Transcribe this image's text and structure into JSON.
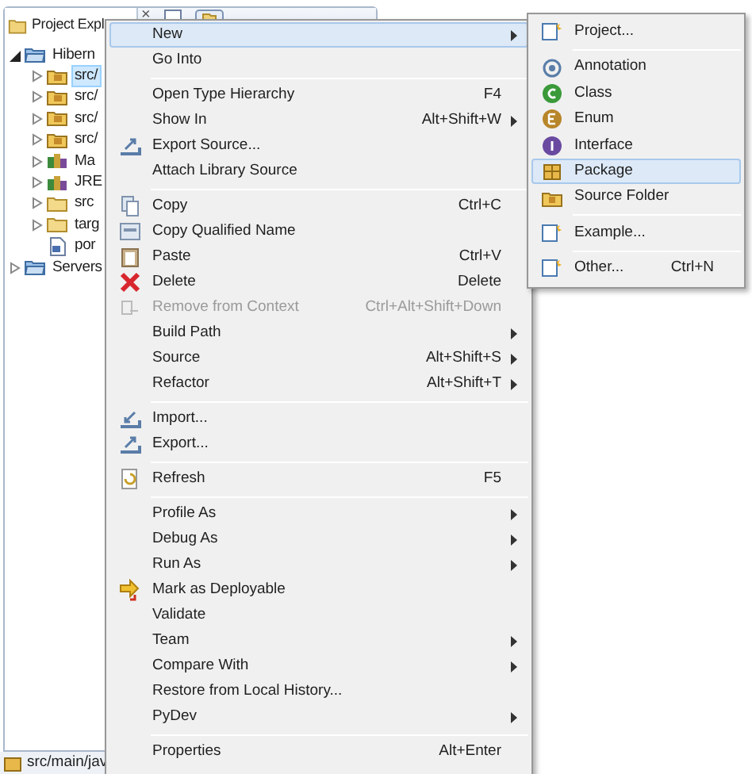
{
  "explorer": {
    "title": "Project Expl",
    "close": "×",
    "tree": [
      {
        "label": "Hibern",
        "kind": "project",
        "expanded": true,
        "selected": false,
        "children": [
          {
            "label": "src/",
            "kind": "source-folder",
            "selected": true
          },
          {
            "label": "src/",
            "kind": "source-folder",
            "selected": false
          },
          {
            "label": "src/",
            "kind": "source-folder",
            "selected": false
          },
          {
            "label": "src/",
            "kind": "source-folder",
            "selected": false
          },
          {
            "label": "Ma",
            "kind": "library",
            "selected": false
          },
          {
            "label": "JRE",
            "kind": "library",
            "selected": false
          },
          {
            "label": "src",
            "kind": "folder",
            "selected": false
          },
          {
            "label": "targ",
            "kind": "folder",
            "selected": false
          },
          {
            "label": "por",
            "kind": "file",
            "selected": false
          }
        ]
      },
      {
        "label": "Servers",
        "kind": "project",
        "expanded": false,
        "selected": false
      }
    ]
  },
  "status_bar": {
    "text": "src/main/jav"
  },
  "context_menu": [
    {
      "kind": "item",
      "label": "New",
      "submenu": true,
      "selected": true,
      "disabled": false
    },
    {
      "kind": "item",
      "label": "Go Into",
      "submenu": false,
      "selected": false,
      "disabled": false
    },
    {
      "kind": "separator"
    },
    {
      "kind": "item",
      "label": "Open Type Hierarchy",
      "shortcut": "F4",
      "submenu": false,
      "selected": false,
      "disabled": false
    },
    {
      "kind": "item",
      "label": "Show In",
      "shortcut": "Alt+Shift+W",
      "submenu": true,
      "selected": false,
      "disabled": false
    },
    {
      "kind": "item",
      "label": "Export Source...",
      "submenu": false,
      "selected": false,
      "disabled": false
    },
    {
      "kind": "item",
      "label": "Attach Library Source",
      "submenu": false,
      "selected": false,
      "disabled": false
    },
    {
      "kind": "separator"
    },
    {
      "kind": "item",
      "label": "Copy",
      "shortcut": "Ctrl+C",
      "submenu": false,
      "selected": false,
      "disabled": false
    },
    {
      "kind": "item",
      "label": "Copy Qualified Name",
      "submenu": false,
      "selected": false,
      "disabled": false
    },
    {
      "kind": "item",
      "label": "Paste",
      "shortcut": "Ctrl+V",
      "submenu": false,
      "selected": false,
      "disabled": false
    },
    {
      "kind": "item",
      "label": "Delete",
      "shortcut": "Delete",
      "submenu": false,
      "selected": false,
      "disabled": false
    },
    {
      "kind": "item",
      "label": "Remove from Context",
      "shortcut": "Ctrl+Alt+Shift+Down",
      "submenu": false,
      "selected": false,
      "disabled": true
    },
    {
      "kind": "item",
      "label": "Build Path",
      "submenu": true,
      "selected": false,
      "disabled": false
    },
    {
      "kind": "item",
      "label": "Source",
      "shortcut": "Alt+Shift+S",
      "submenu": true,
      "selected": false,
      "disabled": false
    },
    {
      "kind": "item",
      "label": "Refactor",
      "shortcut": "Alt+Shift+T",
      "submenu": true,
      "selected": false,
      "disabled": false
    },
    {
      "kind": "separator"
    },
    {
      "kind": "item",
      "label": "Import...",
      "submenu": false,
      "selected": false,
      "disabled": false
    },
    {
      "kind": "item",
      "label": "Export...",
      "submenu": false,
      "selected": false,
      "disabled": false
    },
    {
      "kind": "separator"
    },
    {
      "kind": "item",
      "label": "Refresh",
      "shortcut": "F5",
      "submenu": false,
      "selected": false,
      "disabled": false
    },
    {
      "kind": "separator"
    },
    {
      "kind": "item",
      "label": "Profile As",
      "submenu": true,
      "selected": false,
      "disabled": false
    },
    {
      "kind": "item",
      "label": "Debug As",
      "submenu": true,
      "selected": false,
      "disabled": false
    },
    {
      "kind": "item",
      "label": "Run As",
      "submenu": true,
      "selected": false,
      "disabled": false
    },
    {
      "kind": "item",
      "label": "Mark as Deployable",
      "submenu": false,
      "selected": false,
      "disabled": false
    },
    {
      "kind": "item",
      "label": "Validate",
      "submenu": false,
      "selected": false,
      "disabled": false
    },
    {
      "kind": "item",
      "label": "Team",
      "submenu": true,
      "selected": false,
      "disabled": false
    },
    {
      "kind": "item",
      "label": "Compare With",
      "submenu": true,
      "selected": false,
      "disabled": false
    },
    {
      "kind": "item",
      "label": "Restore from Local History...",
      "submenu": false,
      "selected": false,
      "disabled": false
    },
    {
      "kind": "item",
      "label": "PyDev",
      "submenu": true,
      "selected": false,
      "disabled": false
    },
    {
      "kind": "separator"
    },
    {
      "kind": "item",
      "label": "Properties",
      "shortcut": "Alt+Enter",
      "submenu": false,
      "selected": false,
      "disabled": false
    }
  ],
  "new_submenu": [
    {
      "kind": "item",
      "label": "Project...",
      "selected": false
    },
    {
      "kind": "separator"
    },
    {
      "kind": "item",
      "label": "Annotation",
      "selected": false
    },
    {
      "kind": "item",
      "label": "Class",
      "selected": false
    },
    {
      "kind": "item",
      "label": "Enum",
      "selected": false
    },
    {
      "kind": "item",
      "label": "Interface",
      "selected": false
    },
    {
      "kind": "item",
      "label": "Package",
      "selected": true
    },
    {
      "kind": "item",
      "label": "Source Folder",
      "selected": false
    },
    {
      "kind": "separator"
    },
    {
      "kind": "item",
      "label": "Example...",
      "selected": false
    },
    {
      "kind": "separator"
    },
    {
      "kind": "item",
      "label": "Other...",
      "shortcut": "Ctrl+N",
      "selected": false
    }
  ]
}
